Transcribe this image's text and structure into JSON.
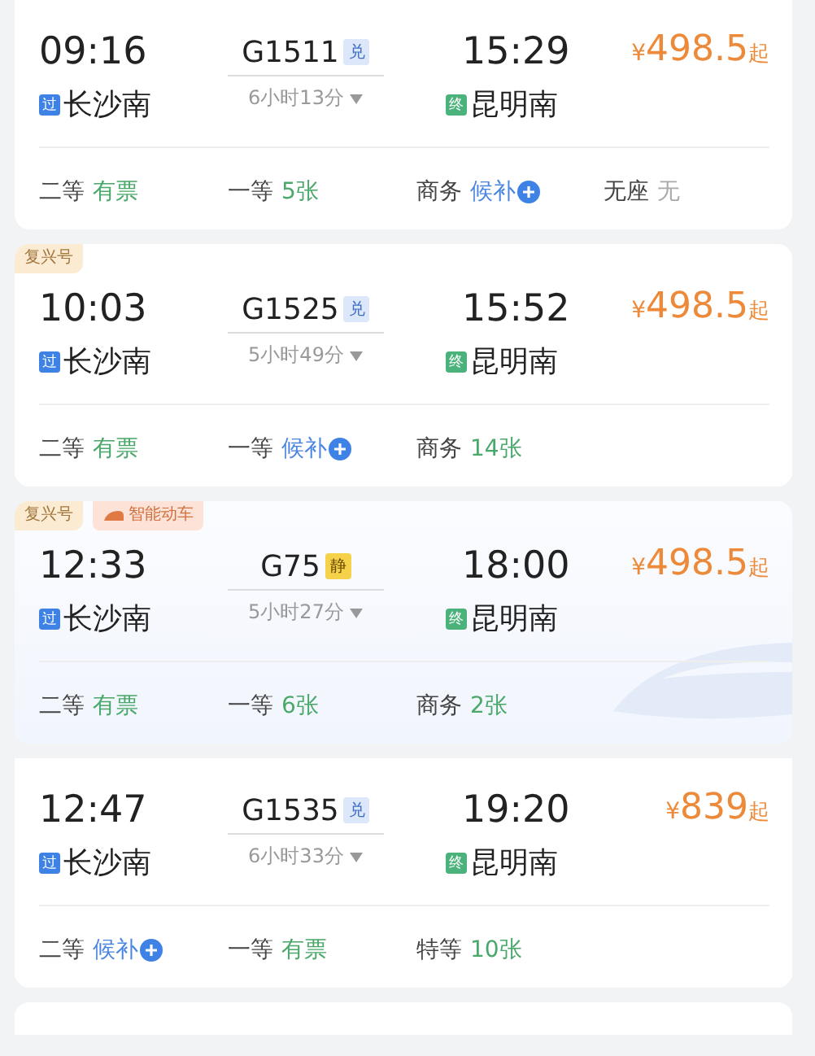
{
  "trains": [
    {
      "highlight": false,
      "depart_time": "09:16",
      "depart_station": "长沙南",
      "depart_badge": {
        "kind": "pass",
        "text": "过"
      },
      "train_no": "G1511",
      "train_tag": {
        "kind": "exchange",
        "text": "兑"
      },
      "duration": "6小时13分",
      "arrive_time": "15:29",
      "arrive_station": "昆明南",
      "arrive_badge": {
        "kind": "end",
        "text": "终"
      },
      "currency": "¥",
      "price": "498.5",
      "price_suffix": "起",
      "seats": [
        {
          "class": "二等",
          "status": "有票",
          "kind": "available"
        },
        {
          "class": "一等",
          "status": "5张",
          "kind": "available"
        },
        {
          "class": "商务",
          "status": "候补",
          "kind": "waitlist"
        },
        {
          "class": "无座",
          "status": "无",
          "kind": "none"
        }
      ]
    },
    {
      "tags": [
        {
          "text": "复兴号",
          "kind": "plain"
        }
      ],
      "highlight": false,
      "depart_time": "10:03",
      "depart_station": "长沙南",
      "depart_badge": {
        "kind": "pass",
        "text": "过"
      },
      "train_no": "G1525",
      "train_tag": {
        "kind": "exchange",
        "text": "兑"
      },
      "duration": "5小时49分",
      "arrive_time": "15:52",
      "arrive_station": "昆明南",
      "arrive_badge": {
        "kind": "end",
        "text": "终"
      },
      "currency": "¥",
      "price": "498.5",
      "price_suffix": "起",
      "seats": [
        {
          "class": "二等",
          "status": "有票",
          "kind": "available"
        },
        {
          "class": "一等",
          "status": "候补",
          "kind": "waitlist"
        },
        {
          "class": "商务",
          "status": "14张",
          "kind": "available"
        }
      ]
    },
    {
      "tags": [
        {
          "text": "复兴号",
          "kind": "plain"
        },
        {
          "text": "智能动车",
          "kind": "smart"
        }
      ],
      "highlight": true,
      "depart_time": "12:33",
      "depart_station": "长沙南",
      "depart_badge": {
        "kind": "pass",
        "text": "过"
      },
      "train_no": "G75",
      "train_tag": {
        "kind": "quiet",
        "text": "静"
      },
      "duration": "5小时27分",
      "arrive_time": "18:00",
      "arrive_station": "昆明南",
      "arrive_badge": {
        "kind": "end",
        "text": "终"
      },
      "currency": "¥",
      "price": "498.5",
      "price_suffix": "起",
      "seats": [
        {
          "class": "二等",
          "status": "有票",
          "kind": "available"
        },
        {
          "class": "一等",
          "status": "6张",
          "kind": "available"
        },
        {
          "class": "商务",
          "status": "2张",
          "kind": "available"
        }
      ]
    },
    {
      "highlight": false,
      "depart_time": "12:47",
      "depart_station": "长沙南",
      "depart_badge": {
        "kind": "pass",
        "text": "过"
      },
      "train_no": "G1535",
      "train_tag": {
        "kind": "exchange",
        "text": "兑"
      },
      "duration": "6小时33分",
      "arrive_time": "19:20",
      "arrive_station": "昆明南",
      "arrive_badge": {
        "kind": "end",
        "text": "终"
      },
      "currency": "¥",
      "price": "839",
      "price_suffix": "起",
      "seats": [
        {
          "class": "二等",
          "status": "候补",
          "kind": "waitlist"
        },
        {
          "class": "一等",
          "status": "有票",
          "kind": "available"
        },
        {
          "class": "特等",
          "status": "10张",
          "kind": "available"
        }
      ]
    }
  ]
}
